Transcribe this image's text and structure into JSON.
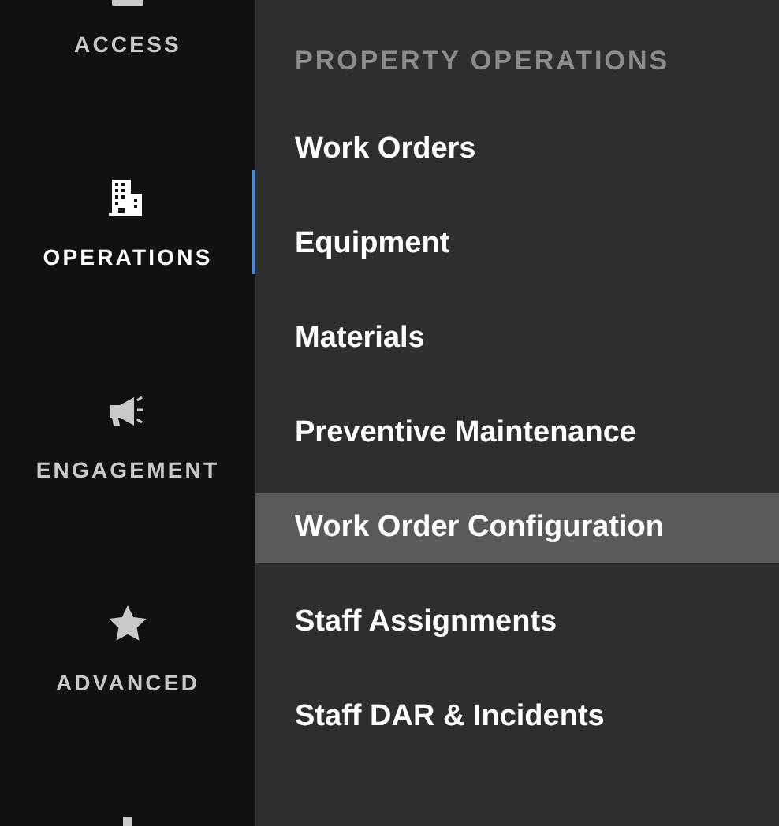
{
  "sidebar": {
    "items": [
      {
        "label": "ACCESS",
        "selected": false
      },
      {
        "label": "OPERATIONS",
        "selected": true
      },
      {
        "label": "ENGAGEMENT",
        "selected": false
      },
      {
        "label": "ADVANCED",
        "selected": false
      },
      {
        "selected": false
      }
    ]
  },
  "submenu": {
    "heading": "PROPERTY OPERATIONS",
    "items": [
      {
        "label": "Work Orders",
        "selected": false
      },
      {
        "label": "Equipment",
        "selected": false
      },
      {
        "label": "Materials",
        "selected": false
      },
      {
        "label": "Preventive Maintenance",
        "selected": false
      },
      {
        "label": "Work Order Configuration",
        "selected": true
      },
      {
        "label": "Staff Assignments",
        "selected": false
      },
      {
        "label": "Staff DAR & Incidents",
        "selected": false
      }
    ]
  }
}
